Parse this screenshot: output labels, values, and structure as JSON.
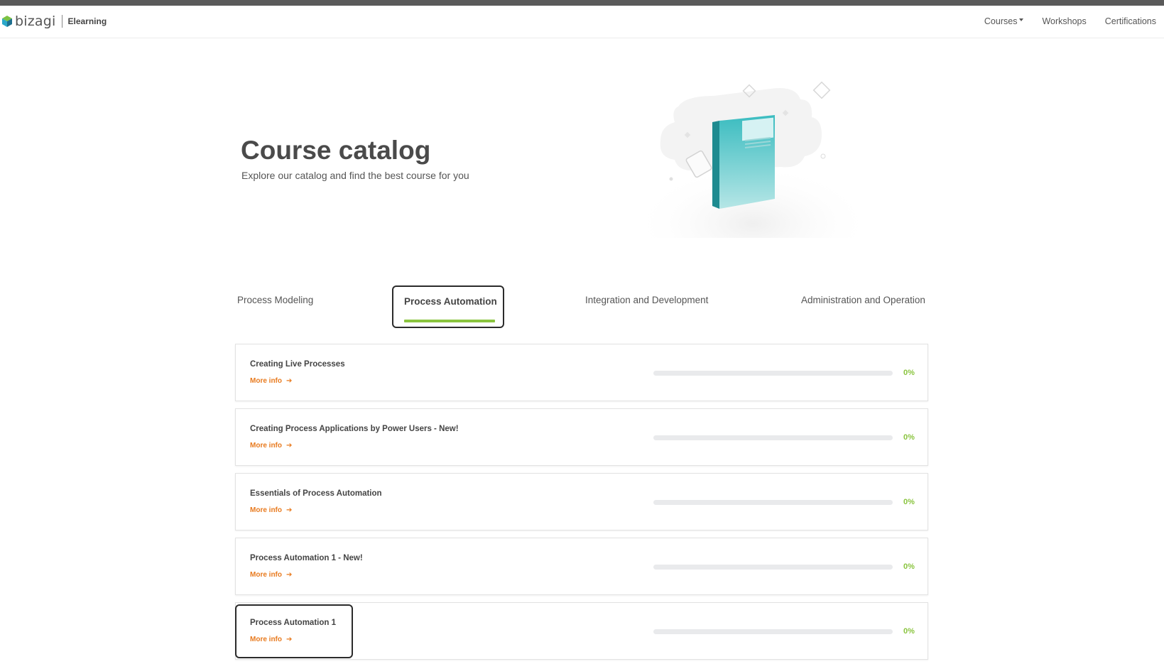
{
  "header": {
    "brand_name": "bizagi",
    "brand_section": "Elearning",
    "nav": {
      "courses_label": "Courses",
      "workshops_label": "Workshops",
      "certifications_label": "Certifications"
    }
  },
  "hero": {
    "title": "Course catalog",
    "subtitle": "Explore our catalog and find the best course for you"
  },
  "tabs": {
    "items": [
      {
        "label": "Process Modeling"
      },
      {
        "label": "Process Automation"
      },
      {
        "label": "Integration and Development"
      },
      {
        "label": "Administration and Operation"
      }
    ],
    "active": "Process Automation"
  },
  "courses": [
    {
      "title": "Creating Live Processes",
      "more_info": "More info",
      "progress": 0,
      "progress_label": "0%"
    },
    {
      "title": "Creating Process Applications by Power Users - New!",
      "more_info": "More info",
      "progress": 0,
      "progress_label": "0%"
    },
    {
      "title": "Essentials of Process Automation",
      "more_info": "More info",
      "progress": 0,
      "progress_label": "0%"
    },
    {
      "title": "Process Automation 1 - New!",
      "more_info": "More info",
      "progress": 0,
      "progress_label": "0%"
    },
    {
      "title": "Process Automation 1",
      "more_info": "More info",
      "progress": 0,
      "progress_label": "0%"
    }
  ],
  "colors": {
    "accent_green": "#8ac43f",
    "link_orange": "#e87a1e",
    "book_teal": "#3bbcc0"
  },
  "icons": {
    "logo": "bizagi-cube-logo-icon",
    "more_info_arrow": "arrow-right-icon",
    "courses_dropdown": "caret-down-icon"
  }
}
